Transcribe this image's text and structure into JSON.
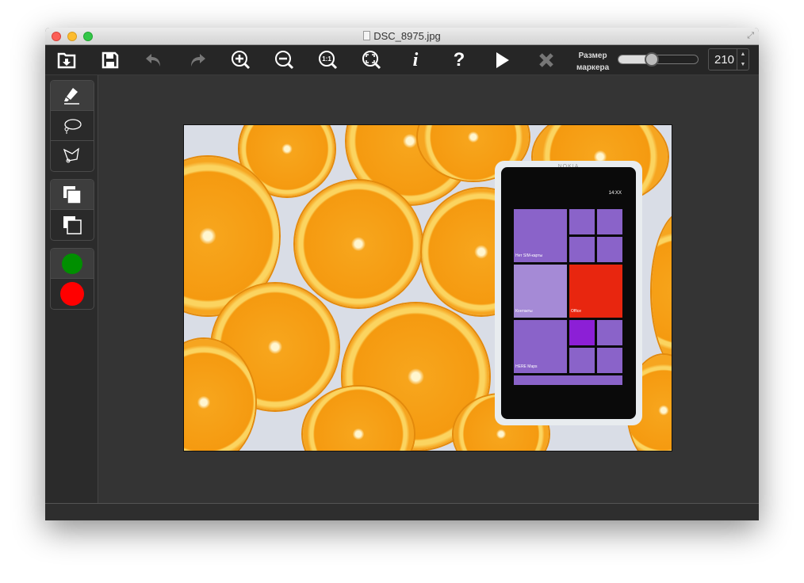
{
  "window": {
    "title": "DSC_8975.jpg"
  },
  "toolbar": {
    "buttons": [
      {
        "name": "open",
        "icon": "folder-download-icon",
        "enabled": true
      },
      {
        "name": "save",
        "icon": "floppy-icon",
        "enabled": true
      },
      {
        "name": "undo",
        "icon": "undo-icon",
        "enabled": false
      },
      {
        "name": "redo",
        "icon": "redo-icon",
        "enabled": false
      },
      {
        "name": "zoom-in",
        "icon": "zoom-in-icon",
        "enabled": true
      },
      {
        "name": "zoom-out",
        "icon": "zoom-out-icon",
        "enabled": true
      },
      {
        "name": "zoom-actual",
        "icon": "zoom-1-1-icon",
        "label": "1:1",
        "enabled": true
      },
      {
        "name": "zoom-fit",
        "icon": "zoom-fit-icon",
        "enabled": true
      },
      {
        "name": "info",
        "icon": "info-icon",
        "label": "i",
        "enabled": true
      },
      {
        "name": "help",
        "icon": "help-icon",
        "label": "?",
        "enabled": true
      },
      {
        "name": "run",
        "icon": "play-icon",
        "enabled": true
      },
      {
        "name": "cancel",
        "icon": "close-icon",
        "enabled": false
      }
    ],
    "marker_label_1": "Размер",
    "marker_label_2": "маркера",
    "marker_size": 210,
    "marker_size_display": "210",
    "slider_percent": 42
  },
  "sidebar": {
    "tools": [
      "marker",
      "lasso",
      "polygon-lasso"
    ],
    "modes": [
      "add-selection",
      "subtract-selection"
    ],
    "colors": [
      {
        "name": "keep",
        "color": "#008f00"
      },
      {
        "name": "remove",
        "color": "#ff0000"
      }
    ]
  },
  "photo": {
    "brand": "NOKIA",
    "clock": "14:XX",
    "tiles": [
      "Нет SIM-карты",
      "Контакты",
      "Office",
      "HERE Maps"
    ]
  }
}
